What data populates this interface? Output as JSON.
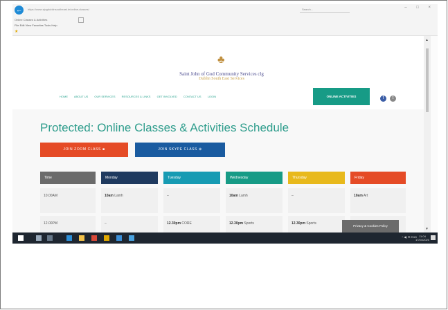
{
  "browser": {
    "back_glyph": "←",
    "url": "https://www.sjogdublinsoutheast.ie/online-classes/",
    "search_placeholder": "Search...",
    "window_controls": "– □ ×",
    "tab_title": "Online Classes & Activities",
    "menu": [
      "File",
      "Edit",
      "View",
      "Favorites",
      "Tools",
      "Help"
    ]
  },
  "site": {
    "logo_glyph": "♣",
    "org_name": "Saint John of God Community Services clg",
    "org_sub": "Dublin South East Services",
    "nav": [
      "HOME",
      "ABOUT US",
      "OUR SERVICES",
      "RESOURCES & LINKS",
      "GET INVOLVED",
      "CONTACT US",
      "LOGIN"
    ],
    "nav_active": "ONLINE ACTIVITIES",
    "social": [
      "f",
      "t"
    ]
  },
  "main": {
    "title": "Protected: Online Classes & Activities Schedule",
    "zoom_button": "JOIN ZOOM CLASS ■",
    "skype_button": "JOIN SKYPE CLASS ⊕"
  },
  "schedule": {
    "headers": [
      "Time",
      "Monday",
      "Tuesday",
      "Wednesday",
      "Thursday",
      "Friday"
    ],
    "header_colors": [
      "#6b6b6b",
      "#1f3a5f",
      "#179bb3",
      "#179b86",
      "#e8b91c",
      "#e54b26"
    ],
    "rows": [
      {
        "time": "10.00AM",
        "cells": [
          [
            "10am",
            "Lamh"
          ],
          [
            "",
            "–"
          ],
          [
            "10am",
            "Lamh"
          ],
          [
            "",
            "–"
          ],
          [
            "10am",
            "Art"
          ]
        ]
      },
      {
        "time": "12.00PM",
        "cells": [
          [
            "",
            "–"
          ],
          [
            "12.30pm",
            "CORE"
          ],
          [
            "12.30pm",
            "Sports"
          ],
          [
            "12.30pm",
            "Sports"
          ],
          [
            "",
            ""
          ]
        ]
      }
    ]
  },
  "overlay": {
    "privacy": "Privacy & Cookies Policy"
  },
  "taskbar": {
    "tray": "^ ◀) ⊡ ENG",
    "time": "11:04",
    "date": "17/04/2020"
  }
}
